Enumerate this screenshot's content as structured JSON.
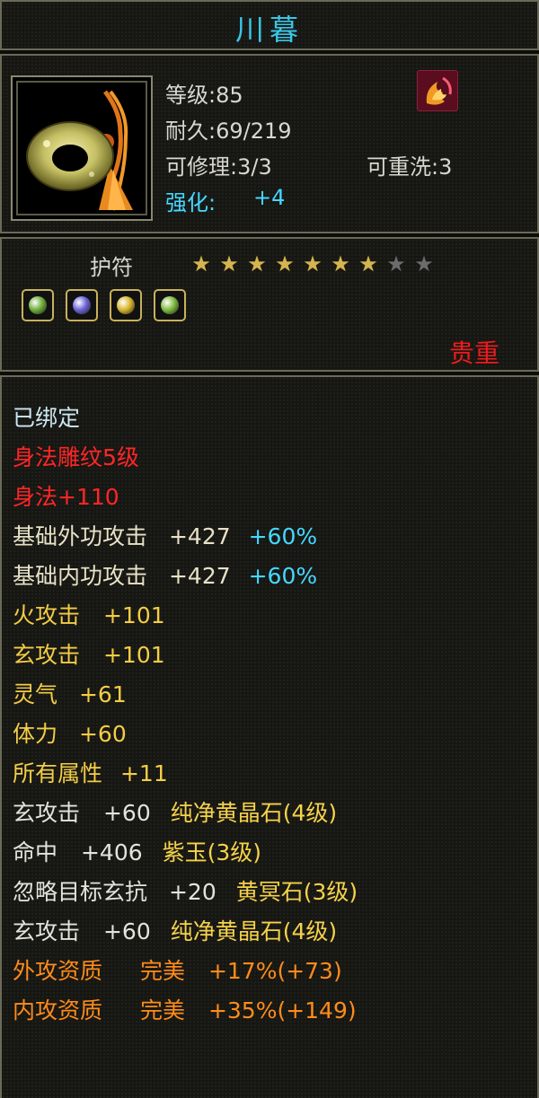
{
  "title": "川暮",
  "item": {
    "level_label": "等级:85",
    "durability_label": "耐久:69/219",
    "repair_label": "可修理:3/3",
    "rewash_label": "可重洗:3",
    "enhance_label": "强化:",
    "enhance_value": "+4",
    "type": "护符",
    "stars_total": 9,
    "stars_filled": 7,
    "rarity": "贵重"
  },
  "gems": [
    {
      "name": "green-gem-icon",
      "color": "#6fae3a"
    },
    {
      "name": "purple-gem-icon",
      "color": "#6d65d8"
    },
    {
      "name": "gold-gem-icon",
      "color": "#d9b42e"
    },
    {
      "name": "green-gem-icon",
      "color": "#7fbb40"
    }
  ],
  "attributes": {
    "bound": "已绑定",
    "engraving": "身法雕纹5级",
    "agility": "身法+110",
    "outer_attack": {
      "label": "基础外功攻击",
      "value": "+427",
      "pct": "+60%"
    },
    "inner_attack": {
      "label": "基础内功攻击",
      "value": "+427",
      "pct": "+60%"
    },
    "fire_attack": {
      "label": "火攻击",
      "value": "+101"
    },
    "mystic_attack": {
      "label": "玄攻击",
      "value": "+101"
    },
    "spirit": {
      "label": "灵气",
      "value": "+61"
    },
    "stamina": {
      "label": "体力",
      "value": "+60"
    },
    "all_attr": {
      "label": "所有属性",
      "value": "+11"
    },
    "gem1": {
      "label": "玄攻击",
      "value": "+60",
      "gem": "纯净黄晶石(4级)"
    },
    "gem2": {
      "label": "命中",
      "value": "+406",
      "gem": "紫玉(3级)"
    },
    "gem3": {
      "label": "忽略目标玄抗",
      "value": "+20",
      "gem": "黄冥石(3级)"
    },
    "gem4": {
      "label": "玄攻击",
      "value": "+60",
      "gem": "纯净黄晶石(4级)"
    },
    "q_outer": {
      "label": "外攻资质",
      "grade": "完美",
      "detail": "+17%(+73)"
    },
    "q_inner": {
      "label": "内攻资质",
      "grade": "完美",
      "detail": "+35%(+149)"
    }
  },
  "colors": {
    "title": "#39c6e6",
    "rarity": "#ee1b1b",
    "enhance": "#45d8ff",
    "orange": "#ff8c1a"
  }
}
